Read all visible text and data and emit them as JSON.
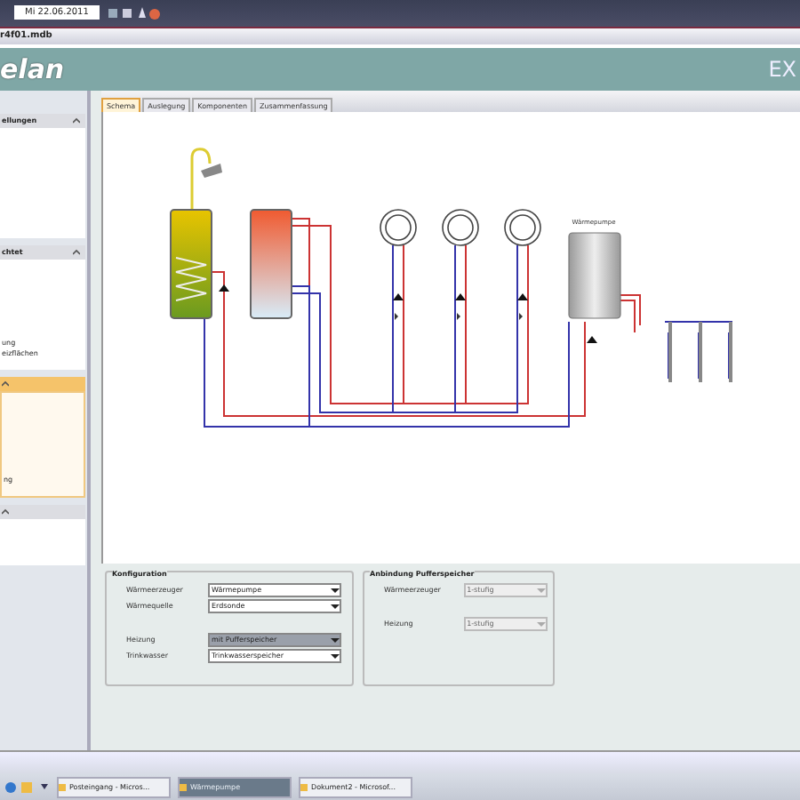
{
  "top_bar": {
    "date": "Mi 22.06.2011"
  },
  "window": {
    "title": "r4f01.mdb",
    "brand": "elan",
    "brand_right": "EX"
  },
  "sidebar": {
    "sections": [
      {
        "header": "ellungen",
        "selected": false
      },
      {
        "header": "chtet",
        "selected": false,
        "items": [
          "ung",
          "eizflächen"
        ]
      },
      {
        "selected": true,
        "items": [
          "ng"
        ]
      },
      {
        "selected": false
      }
    ]
  },
  "tabs": [
    {
      "label": "Schema",
      "selected": true
    },
    {
      "label": "Auslegung",
      "selected": false
    },
    {
      "label": "Komponenten",
      "selected": false
    },
    {
      "label": "Zusammenfassung",
      "selected": false
    }
  ],
  "diagram": {
    "heat_pump_label": "Wärmepumpe"
  },
  "groups": [
    {
      "title": "Konfiguration",
      "blocks": [
        [
          {
            "label": "Wärmeerzeuger",
            "value": "Wärmepumpe",
            "disabled": false,
            "highlighted": false
          },
          {
            "label": "Wärmequelle",
            "value": "Erdsonde",
            "disabled": false,
            "highlighted": false
          }
        ],
        [
          {
            "label": "Heizung",
            "value": "mit Pufferspeicher",
            "disabled": false,
            "highlighted": true
          },
          {
            "label": "Trinkwasser",
            "value": "Trinkwasserspeicher",
            "disabled": false,
            "highlighted": false
          }
        ]
      ]
    },
    {
      "title": "Anbindung Pufferspeicher",
      "blocks": [
        [
          {
            "label": "Wärmeerzeuger",
            "value": "1-stufig",
            "disabled": true
          }
        ],
        [
          {
            "label": "Heizung",
            "value": "1-stufig",
            "disabled": true
          }
        ]
      ]
    }
  ],
  "taskbar": {
    "tasks": [
      {
        "label": "Posteingang - Micros...",
        "selected": false
      },
      {
        "label": "Wärmepumpe",
        "selected": true
      },
      {
        "label": "Dokument2 - Microsof...",
        "selected": false
      }
    ]
  }
}
